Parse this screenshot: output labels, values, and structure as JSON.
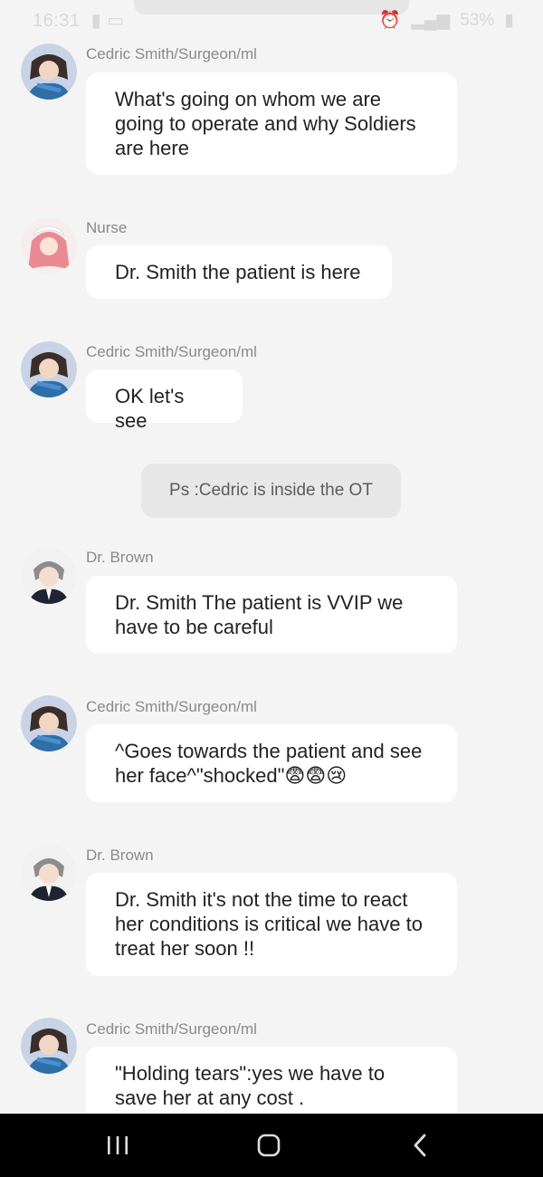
{
  "status_bar": {
    "time": "16:31",
    "battery": "53%"
  },
  "messages": [
    {
      "sender": "Cedric Smith/Surgeon/ml",
      "avatar": "cedric-avatar",
      "text": "What's going on whom we are going to operate and why Soldiers are here"
    },
    {
      "sender": "Nurse",
      "avatar": "nurse-avatar",
      "text": "Dr. Smith the patient is here"
    },
    {
      "sender": "Cedric Smith/Surgeon/ml",
      "avatar": "cedric-avatar",
      "text": "OK let's see"
    },
    {
      "sender": "Dr. Brown",
      "avatar": "brown-avatar",
      "text": "Dr. Smith The patient is VVIP we have to be careful"
    },
    {
      "sender": "Cedric Smith/Surgeon/ml",
      "avatar": "cedric-avatar",
      "text": "^Goes towards the patient and see her face^\"shocked\"😨😨😢"
    },
    {
      "sender": "Dr. Brown",
      "avatar": "brown-avatar",
      "text": "Dr. Smith it's not the time to react her conditions is critical we have to treat her soon !!"
    },
    {
      "sender": "Cedric Smith/Surgeon/ml",
      "avatar": "cedric-avatar",
      "text": "\"Holding tears\":yes we have to save her at any cost ."
    }
  ],
  "narration": "Ps :Cedric is inside the OT",
  "nav": {
    "recents_icon": "recents-icon",
    "home_icon": "home-icon",
    "back_icon": "back-icon"
  }
}
